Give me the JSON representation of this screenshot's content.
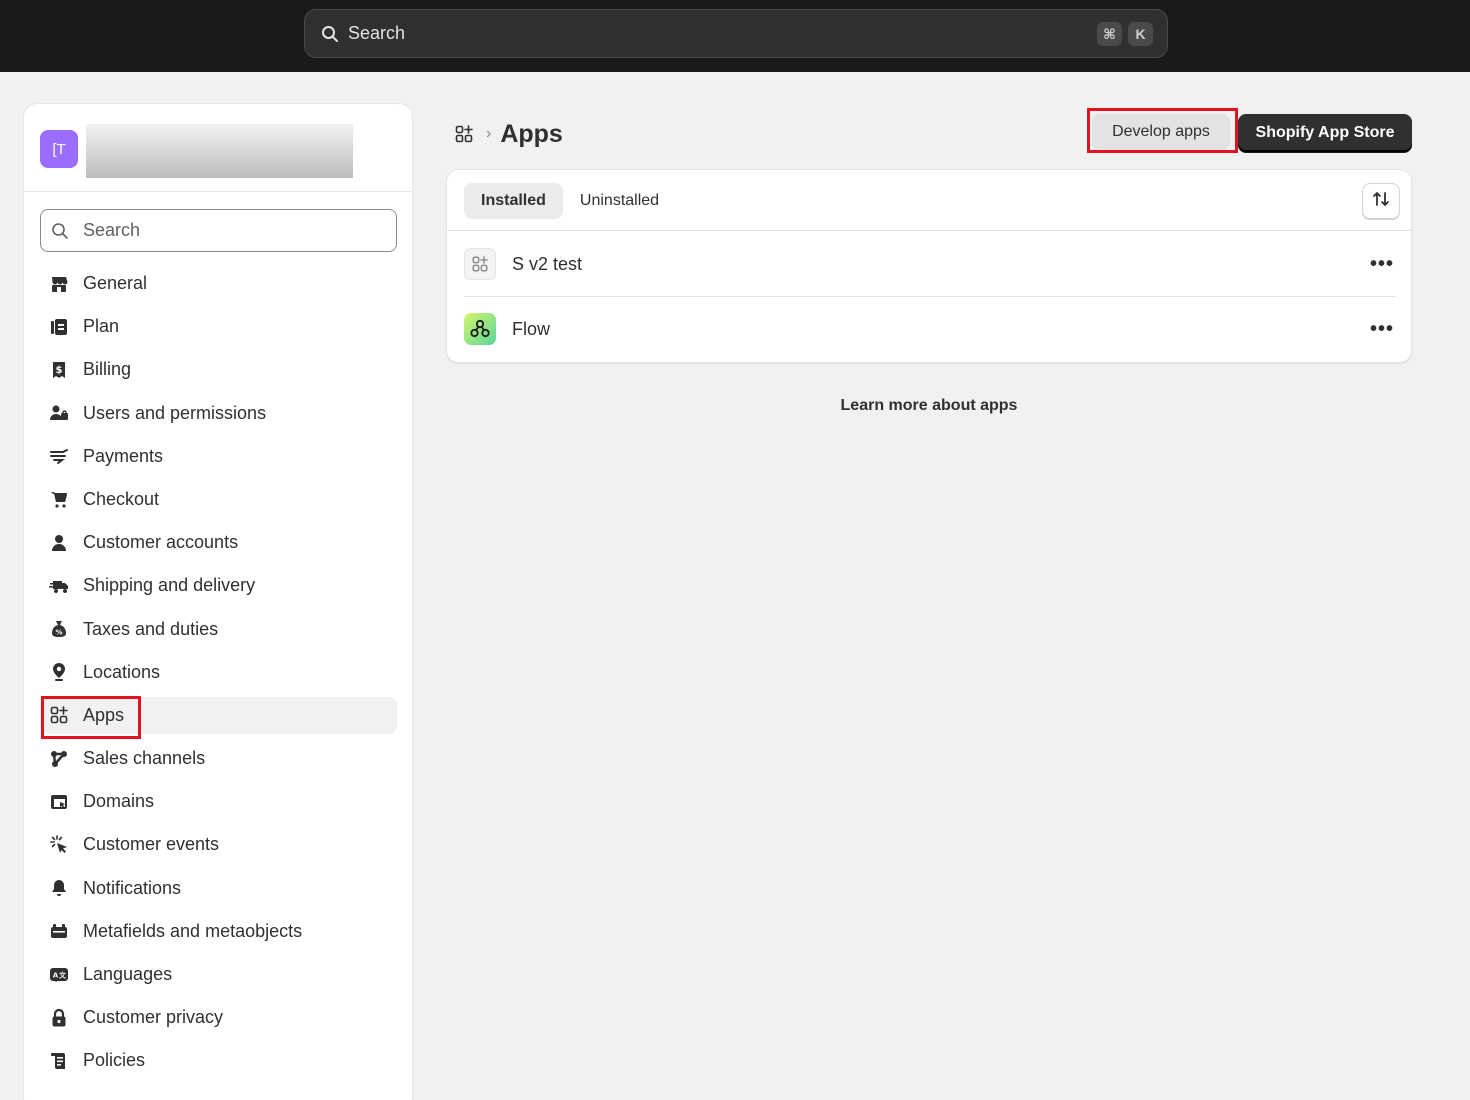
{
  "topbar": {
    "search_placeholder": "Search",
    "shortcut_cmd": "⌘",
    "shortcut_key": "K"
  },
  "sidebar": {
    "store_avatar": "[T",
    "search_placeholder": "Search",
    "items": [
      {
        "label": "General",
        "icon": "store-icon"
      },
      {
        "label": "Plan",
        "icon": "plan-icon"
      },
      {
        "label": "Billing",
        "icon": "receipt-icon"
      },
      {
        "label": "Users and permissions",
        "icon": "users-icon"
      },
      {
        "label": "Payments",
        "icon": "hand-money-icon"
      },
      {
        "label": "Checkout",
        "icon": "cart-icon"
      },
      {
        "label": "Customer accounts",
        "icon": "person-icon"
      },
      {
        "label": "Shipping and delivery",
        "icon": "truck-icon"
      },
      {
        "label": "Taxes and duties",
        "icon": "money-bag-icon"
      },
      {
        "label": "Locations",
        "icon": "location-pin-icon"
      },
      {
        "label": "Apps",
        "icon": "apps-icon",
        "active": true
      },
      {
        "label": "Sales channels",
        "icon": "channels-icon"
      },
      {
        "label": "Domains",
        "icon": "domains-icon"
      },
      {
        "label": "Customer events",
        "icon": "cursor-click-icon"
      },
      {
        "label": "Notifications",
        "icon": "bell-icon"
      },
      {
        "label": "Metafields and metaobjects",
        "icon": "metafields-icon"
      },
      {
        "label": "Languages",
        "icon": "translate-icon"
      },
      {
        "label": "Customer privacy",
        "icon": "lock-icon"
      },
      {
        "label": "Policies",
        "icon": "policy-icon"
      }
    ]
  },
  "main": {
    "breadcrumb_title": "Apps",
    "develop_apps_label": "Develop apps",
    "app_store_label": "Shopify App Store",
    "tabs": [
      {
        "label": "Installed",
        "selected": true
      },
      {
        "label": "Uninstalled",
        "selected": false
      }
    ],
    "apps": [
      {
        "name": "S v2 test",
        "icon": "apps-icon"
      },
      {
        "name": "Flow",
        "icon": "flow-icon"
      }
    ],
    "more_label": "•••",
    "learn_more": "Learn more about apps"
  },
  "colors": {
    "topbar": "#1a1a1a",
    "highlight": "#e0141e",
    "avatar": "#9b6dff",
    "primary_button": "#303030"
  }
}
